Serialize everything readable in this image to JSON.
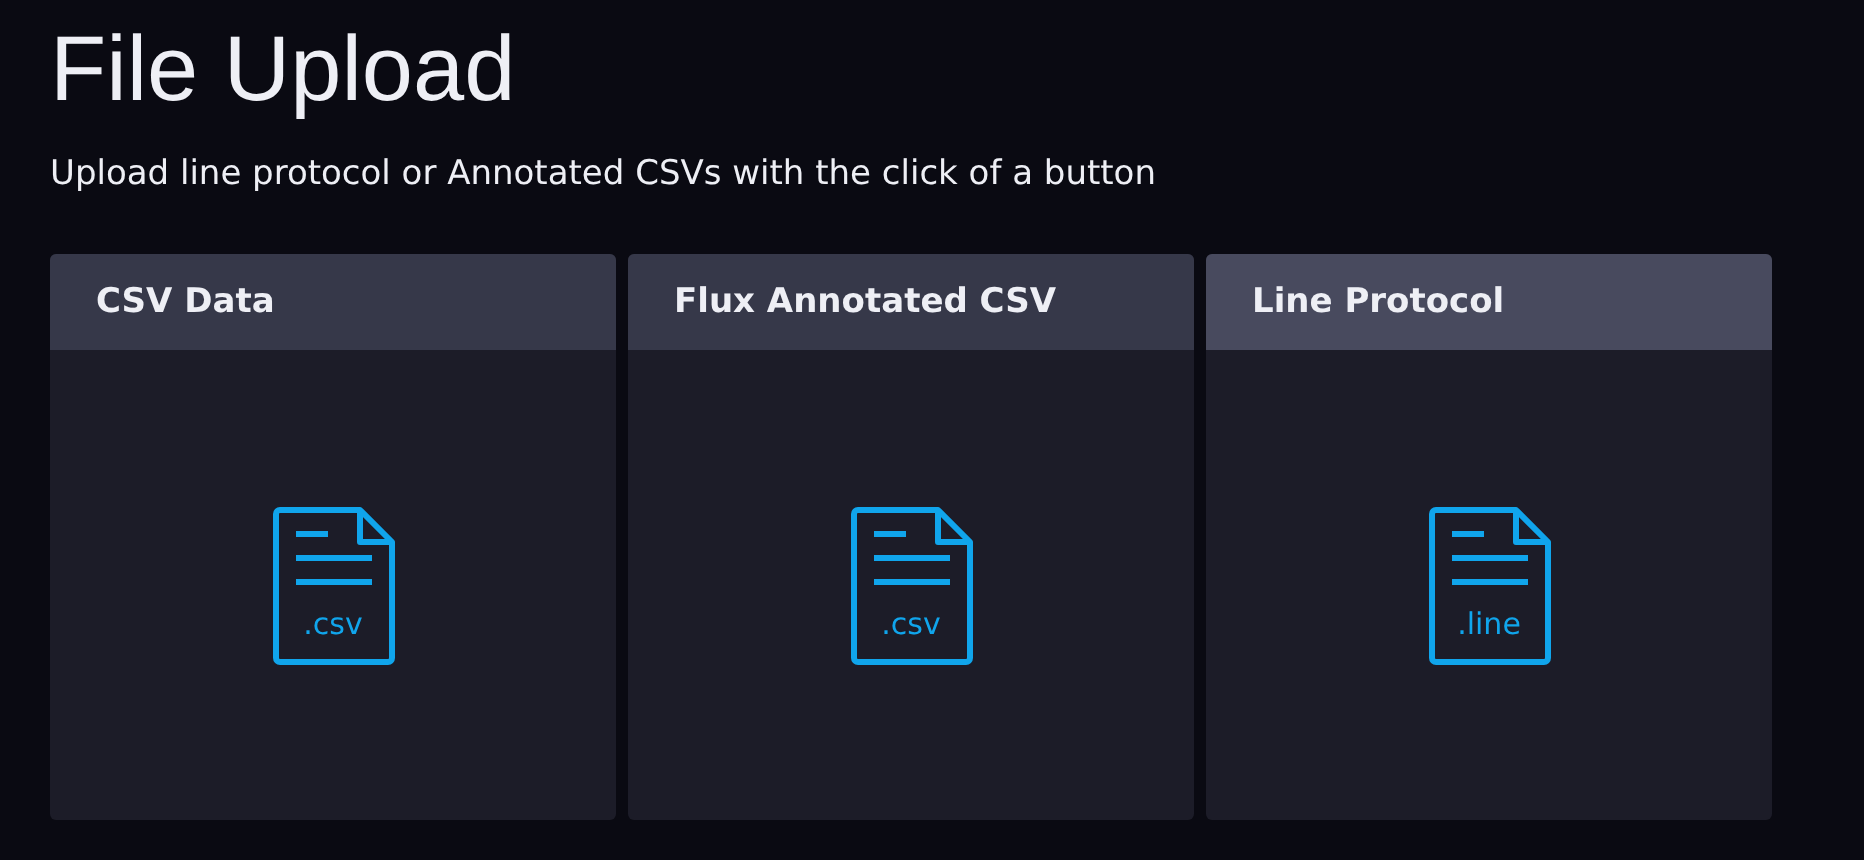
{
  "page": {
    "title": "File Upload",
    "subtitle": "Upload line protocol or Annotated CSVs with the click of a button"
  },
  "cards": [
    {
      "title": "CSV Data",
      "extension": ".csv",
      "selected": false
    },
    {
      "title": "Flux Annotated CSV",
      "extension": ".csv",
      "selected": false
    },
    {
      "title": "Line Protocol",
      "extension": ".line",
      "selected": true
    }
  ]
}
